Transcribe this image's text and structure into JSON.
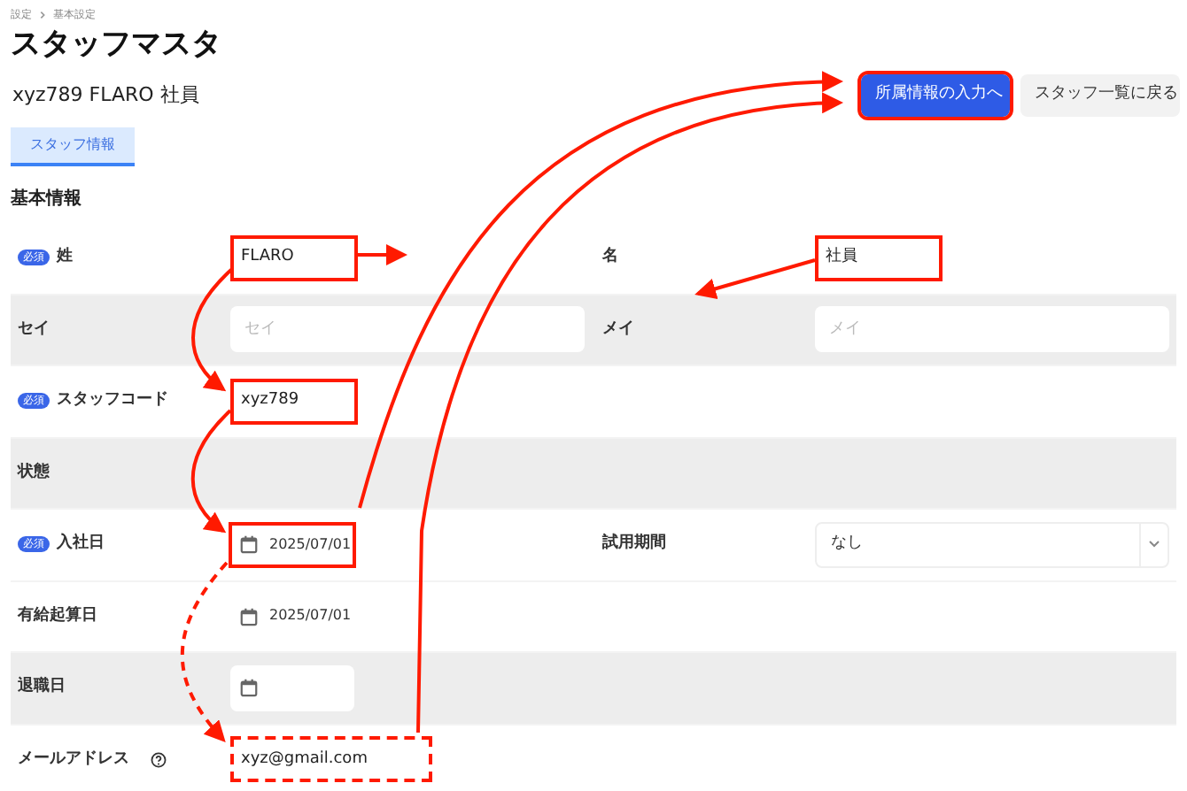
{
  "breadcrumb": [
    "設定",
    "基本設定"
  ],
  "title": "スタッフマスタ",
  "subtitle": "xyz789 FLARO 社員",
  "buttons": [
    {
      "label": "所属情報の入力へ",
      "kind": "primary",
      "highlight": true
    },
    {
      "label": "スタッフ一覧に戻る",
      "kind": "secondary",
      "highlight": false
    }
  ],
  "tabs": [
    {
      "label": "スタッフ情報",
      "selected": true
    }
  ],
  "section": "基本情報",
  "rows": [
    {
      "shaded": false,
      "items": [
        {
          "label": "姓",
          "badge": "必須",
          "field": {
            "kind": "text",
            "value": "FLARO",
            "highlighted": true,
            "dashed": false
          }
        },
        {
          "label": "名",
          "field": {
            "kind": "text",
            "value": "社員",
            "highlighted": true,
            "dashed": false
          }
        }
      ]
    },
    {
      "shaded": true,
      "items": [
        {
          "label": "セイ",
          "field": {
            "kind": "text",
            "placeholder": "セイ"
          }
        },
        {
          "label": "メイ",
          "field": {
            "kind": "text",
            "placeholder": "メイ"
          }
        }
      ]
    },
    {
      "shaded": false,
      "items": [
        {
          "label": "スタッフコード",
          "badge": "必須",
          "field": {
            "kind": "code",
            "value": "xyz789",
            "highlighted": true,
            "dashed": false
          }
        }
      ]
    },
    {
      "shaded": true,
      "items": [
        {
          "label": "状態"
        }
      ]
    },
    {
      "shaded": false,
      "items": [
        {
          "label": "入社日",
          "badge": "必須",
          "field": {
            "kind": "date",
            "value": "2025/07/01",
            "highlighted": true,
            "dashed": false
          }
        },
        {
          "label": "試用期間",
          "field": {
            "kind": "select",
            "value": "なし"
          }
        }
      ]
    },
    {
      "shaded": false,
      "items": [
        {
          "label": "有給起算日",
          "field": {
            "kind": "date",
            "value": "2025/07/01"
          }
        }
      ]
    },
    {
      "shaded": true,
      "items": [
        {
          "label": "退職日",
          "field": {
            "kind": "date"
          }
        }
      ]
    },
    {
      "shaded": false,
      "items": [
        {
          "label": "メールアドレス",
          "help": true,
          "field": {
            "kind": "wide",
            "value": "xyz@gmail.com",
            "highlighted": true,
            "dashed": true
          }
        }
      ]
    }
  ]
}
